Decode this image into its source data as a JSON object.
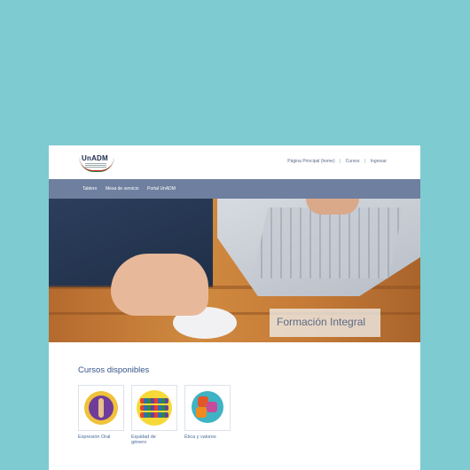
{
  "header": {
    "logo_text": "UnADM",
    "links": [
      "Página Principal (home)",
      "Cursos",
      "Ingresar"
    ]
  },
  "nav": {
    "items": [
      "Tablero",
      "Mesa de servicio",
      "Portal UnADM"
    ]
  },
  "hero": {
    "caption": "Formación Integral"
  },
  "courses": {
    "title": "Cursos disponibles",
    "items": [
      {
        "label": "Expresión Oral",
        "icon": "speaker-illustration-icon"
      },
      {
        "label": "Equidad de género",
        "icon": "people-group-illustration-icon"
      },
      {
        "label": "Ética y valores",
        "icon": "puzzle-illustration-icon"
      }
    ]
  },
  "colors": {
    "background": "#7ecbd1",
    "navbar": "#6e7f9f",
    "link": "#35558a"
  }
}
